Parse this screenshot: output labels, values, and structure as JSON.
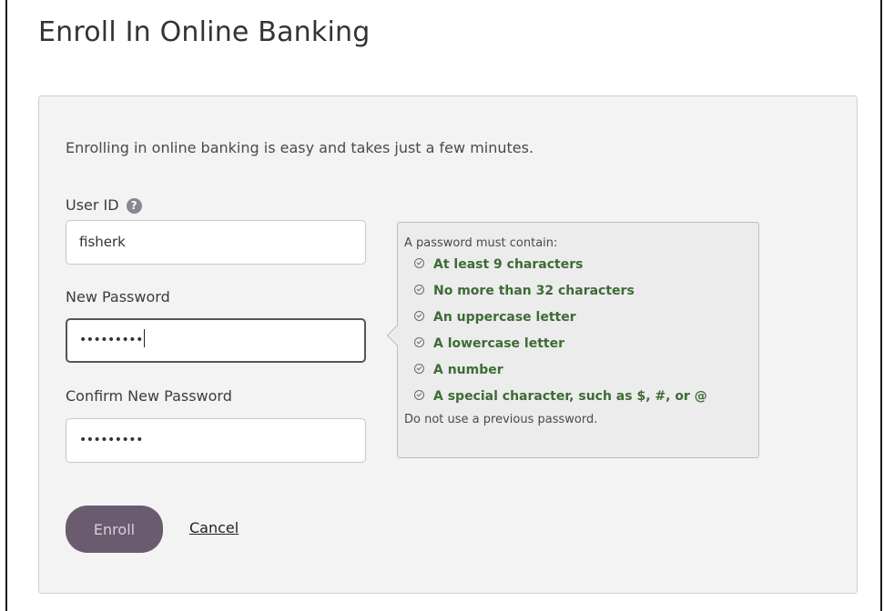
{
  "page": {
    "title": "Enroll In Online Banking"
  },
  "form": {
    "intro": "Enrolling in online banking is easy and takes just a few minutes.",
    "user_id": {
      "label": "User ID",
      "value": "fisherk",
      "help_icon": "question-circle-icon"
    },
    "new_password": {
      "label": "New Password",
      "value": "•••••••••"
    },
    "confirm_password": {
      "label": "Confirm New Password",
      "value": "•••••••••"
    },
    "enroll_label": "Enroll",
    "cancel_label": "Cancel"
  },
  "password_tooltip": {
    "heading": "A password must contain:",
    "rules": [
      "At least 9 characters",
      "No more than 32 characters",
      "An uppercase letter",
      "A lowercase letter",
      "A number",
      "A special character, such as $, #, or @"
    ],
    "footer": "Do not use a previous password.",
    "rule_icon": "check-circle-icon"
  },
  "colors": {
    "button_bg": "#6a5b6e",
    "rule_met": "#3d6b35",
    "card_bg": "#f3f3f3"
  }
}
